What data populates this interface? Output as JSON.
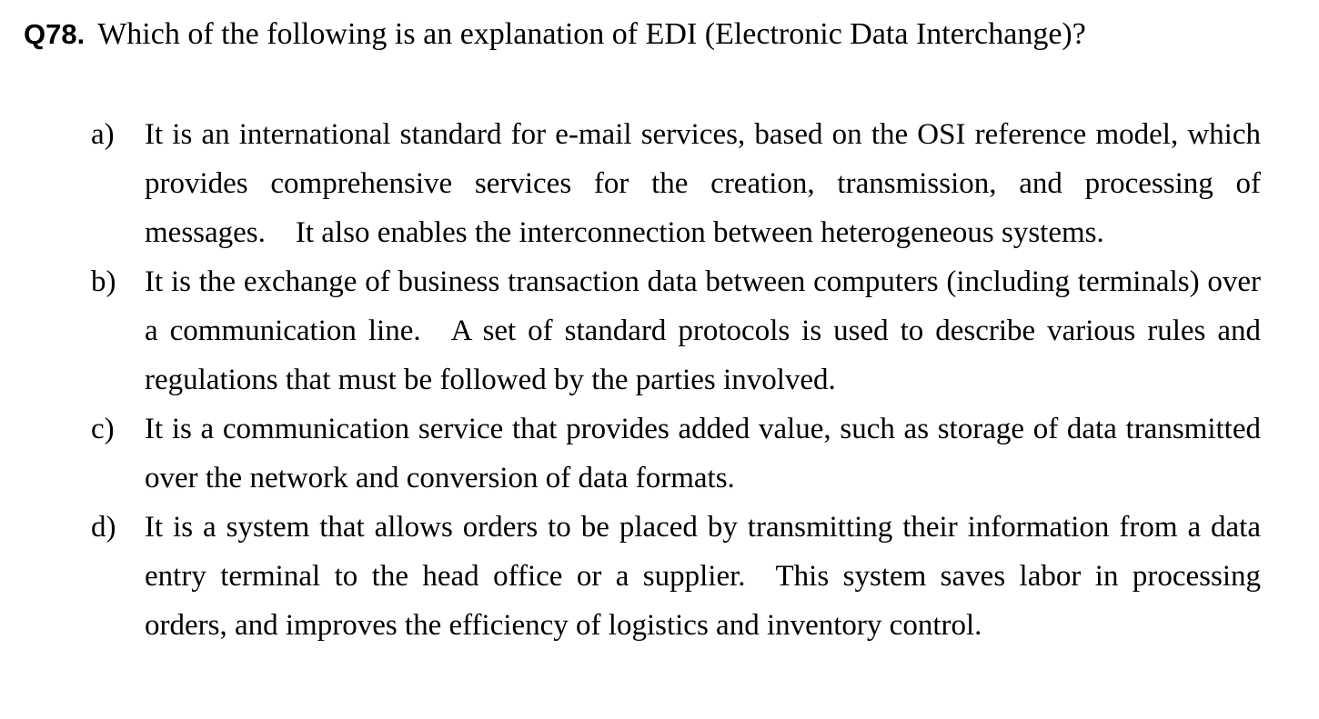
{
  "question": {
    "number": "Q78.",
    "text": "Which of the following is an explanation of EDI (Electronic Data Interchange)?"
  },
  "options": [
    {
      "label": "a)",
      "text": "It is an international standard for e-mail services, based on the OSI reference model, which provides comprehensive services for the creation, transmission, and processing of messages. It also enables the interconnection between heterogeneous systems."
    },
    {
      "label": "b)",
      "text": "It is the exchange of business transaction data between computers (including terminals) over a communication line. A set of standard protocols is used to describe various rules and regulations that must be followed by the parties involved."
    },
    {
      "label": "c)",
      "text": "It is a communication service that provides added value, such as storage of data transmitted over the network and conversion of data formats."
    },
    {
      "label": "d)",
      "text": "It is a system that allows orders to be placed by transmitting their information from a data entry terminal to the head office or a supplier. This system saves labor in processing orders, and improves the efficiency of logistics and inventory control."
    }
  ]
}
